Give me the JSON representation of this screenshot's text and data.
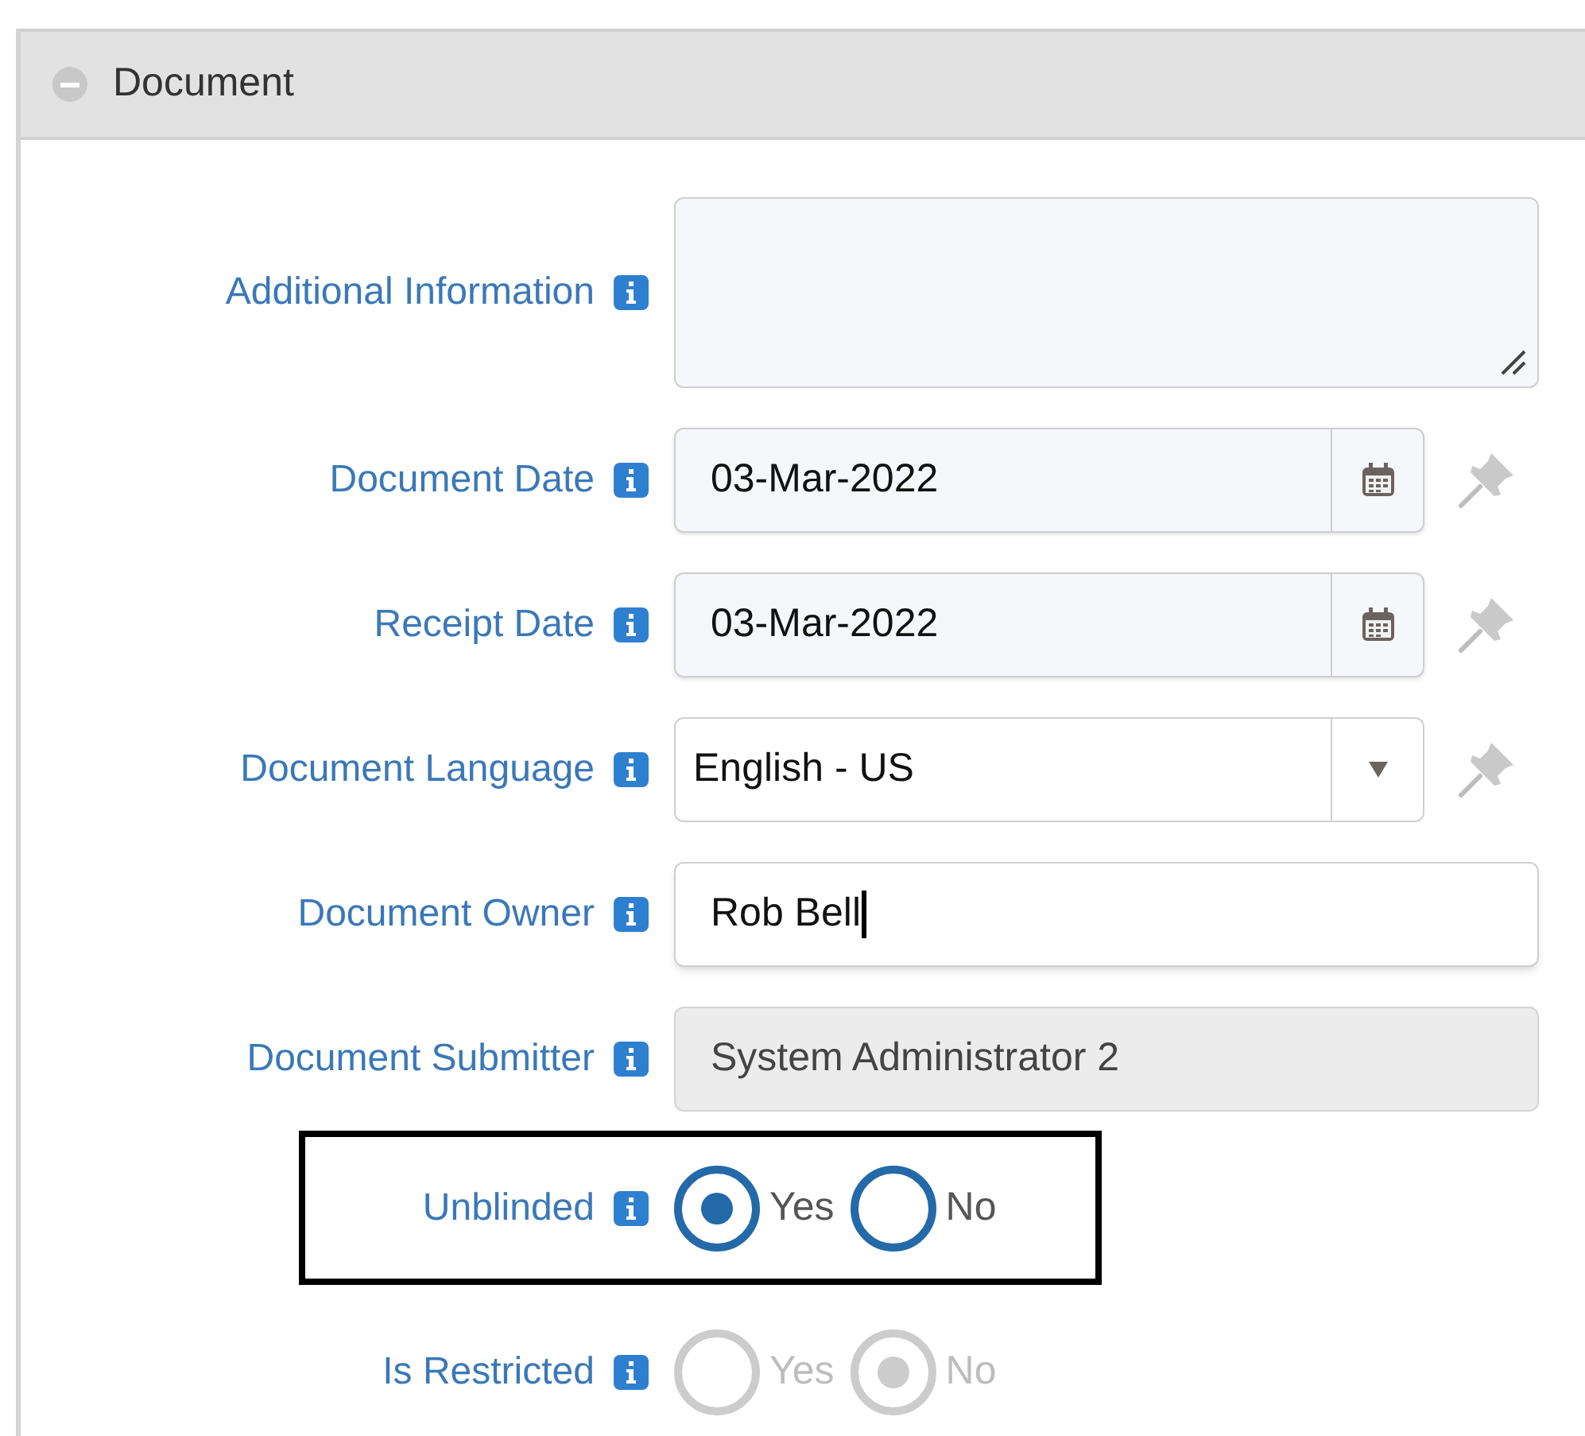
{
  "section": {
    "title": "Document",
    "expanded": true
  },
  "fields": [
    {
      "kind": "textarea",
      "label": "Additional Information"
    },
    {
      "kind": "date",
      "label": "Document Date",
      "value": "03-Mar-2022",
      "pinnable": true
    },
    {
      "kind": "date",
      "label": "Receipt Date",
      "value": "03-Mar-2022",
      "pinnable": true
    },
    {
      "kind": "select",
      "label": "Document Language",
      "value": "English - US",
      "pinnable": true
    },
    {
      "kind": "text",
      "label": "Document Owner",
      "value": "Rob Bell",
      "focused": true
    },
    {
      "kind": "readonly",
      "label": "Document Submitter",
      "value": "System Administrator 2"
    },
    {
      "kind": "radio",
      "label": "Unblinded",
      "disabled": false,
      "highlighted": true,
      "options": [
        {
          "label": "Yes",
          "selected": true
        },
        {
          "label": "No",
          "selected": false
        }
      ]
    },
    {
      "kind": "radio",
      "label": "Is Restricted",
      "disabled": true,
      "options": [
        {
          "label": "Yes",
          "selected": false
        },
        {
          "label": "No",
          "selected": true
        }
      ]
    }
  ]
}
